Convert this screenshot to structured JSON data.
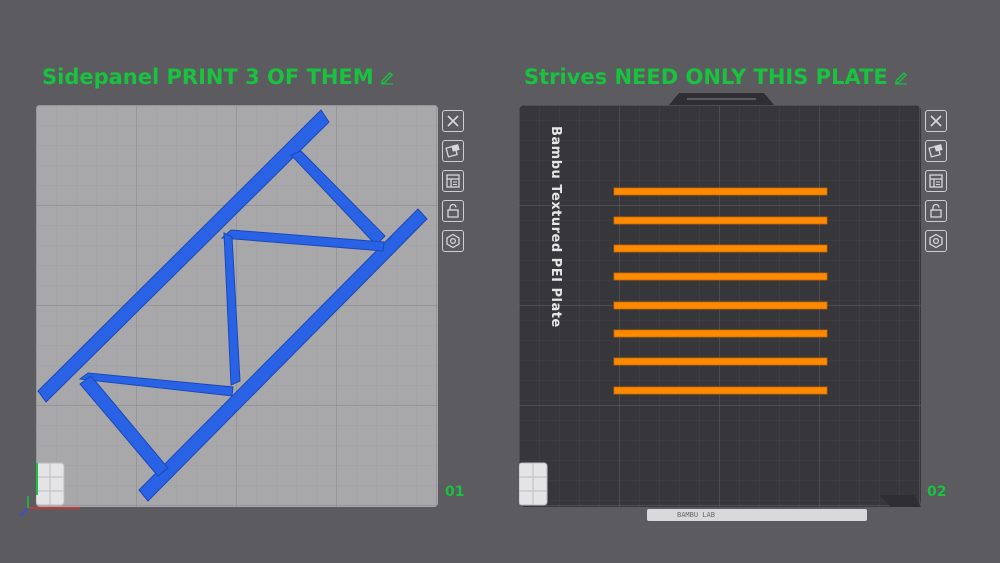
{
  "plates": [
    {
      "title": "Sidepanel PRINT 3 OF THEM",
      "number": "01",
      "bed_color": "#a8a8ab",
      "part_color": "#2a62e6"
    },
    {
      "title": "Strives NEED ONLY THIS PLATE",
      "number": "02",
      "bed_label": "Bambu Textured PEI Plate",
      "bed_color": "#37373b",
      "part_color": "#ff8a00",
      "strip_count": 8,
      "bottom_bar_text": "BAMBU LAB"
    }
  ],
  "toolbar_icons": [
    "close-icon",
    "auto-arrange-icon",
    "plate-settings-icon",
    "lock-icon",
    "orient-icon"
  ],
  "accent_color": "#19c23f"
}
